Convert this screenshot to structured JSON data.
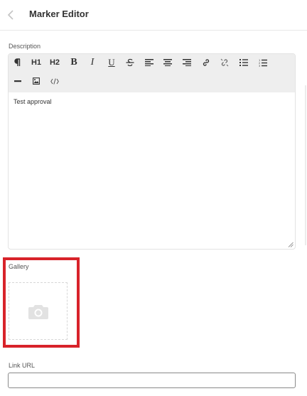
{
  "header": {
    "title": "Marker Editor",
    "back_icon": "chevron-left-icon"
  },
  "description": {
    "label": "Description",
    "content": "Test approval",
    "toolbar": {
      "paragraph_icon": "paragraph-icon",
      "h1": "H1",
      "h2": "H2",
      "bold": "B",
      "italic": "I",
      "underline": "U",
      "strike_icon": "strikethrough-icon",
      "align_left_icon": "align-left-icon",
      "align_center_icon": "align-center-icon",
      "align_right_icon": "align-right-icon",
      "link_icon": "link-icon",
      "unlink_icon": "unlink-icon",
      "bullet_list_icon": "bullet-list-icon",
      "numbered_list_icon": "numbered-list-icon",
      "hr_icon": "horizontal-rule-icon",
      "image_icon": "image-icon",
      "code_icon": "code-icon"
    }
  },
  "gallery": {
    "label": "Gallery",
    "upload_icon": "camera-icon",
    "highlight_color": "#d8232a"
  },
  "link_url": {
    "label": "Link URL",
    "value": "",
    "placeholder": ""
  }
}
